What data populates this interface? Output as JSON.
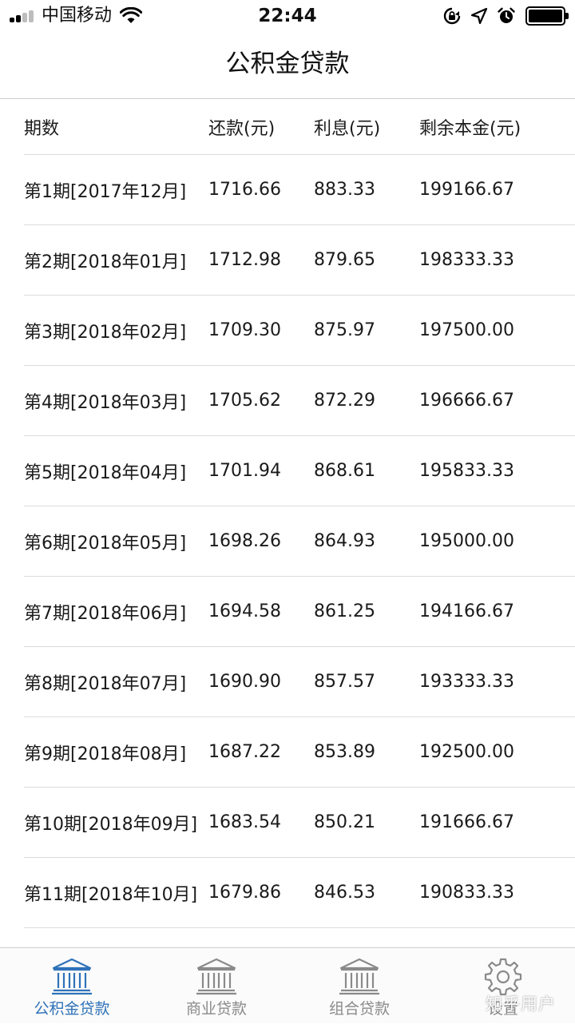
{
  "status_bar": {
    "carrier": "中国移动",
    "time": "22:44",
    "icons": [
      "signal-icon",
      "wifi-icon",
      "rotation-lock-icon",
      "location-icon",
      "alarm-icon",
      "battery-icon"
    ]
  },
  "header": {
    "title": "公积金贷款"
  },
  "table": {
    "columns": [
      "期数",
      "还款(元)",
      "利息(元)",
      "剩余本金(元)"
    ],
    "rows": [
      [
        "第1期[2017年12月]",
        "1716.66",
        "883.33",
        "199166.67"
      ],
      [
        "第2期[2018年01月]",
        "1712.98",
        "879.65",
        "198333.33"
      ],
      [
        "第3期[2018年02月]",
        "1709.30",
        "875.97",
        "197500.00"
      ],
      [
        "第4期[2018年03月]",
        "1705.62",
        "872.29",
        "196666.67"
      ],
      [
        "第5期[2018年04月]",
        "1701.94",
        "868.61",
        "195833.33"
      ],
      [
        "第6期[2018年05月]",
        "1698.26",
        "864.93",
        "195000.00"
      ],
      [
        "第7期[2018年06月]",
        "1694.58",
        "861.25",
        "194166.67"
      ],
      [
        "第8期[2018年07月]",
        "1690.90",
        "857.57",
        "193333.33"
      ],
      [
        "第9期[2018年08月]",
        "1687.22",
        "853.89",
        "192500.00"
      ],
      [
        "第10期[2018年09月]",
        "1683.54",
        "850.21",
        "191666.67"
      ],
      [
        "第11期[2018年10月]",
        "1679.86",
        "846.53",
        "190833.33"
      ]
    ]
  },
  "tabbar": {
    "tabs": [
      {
        "label": "公积金贷款",
        "icon": "bank-icon",
        "active": true
      },
      {
        "label": "商业贷款",
        "icon": "bank-icon",
        "active": false
      },
      {
        "label": "组合贷款",
        "icon": "bank-icon",
        "active": false
      },
      {
        "label": "设置",
        "icon": "gear-icon",
        "active": false
      }
    ]
  },
  "watermark": "知乎用户",
  "colors": {
    "accent": "#2f72b8",
    "inactive": "#8a8a8a",
    "divider": "#dcdcdc"
  }
}
